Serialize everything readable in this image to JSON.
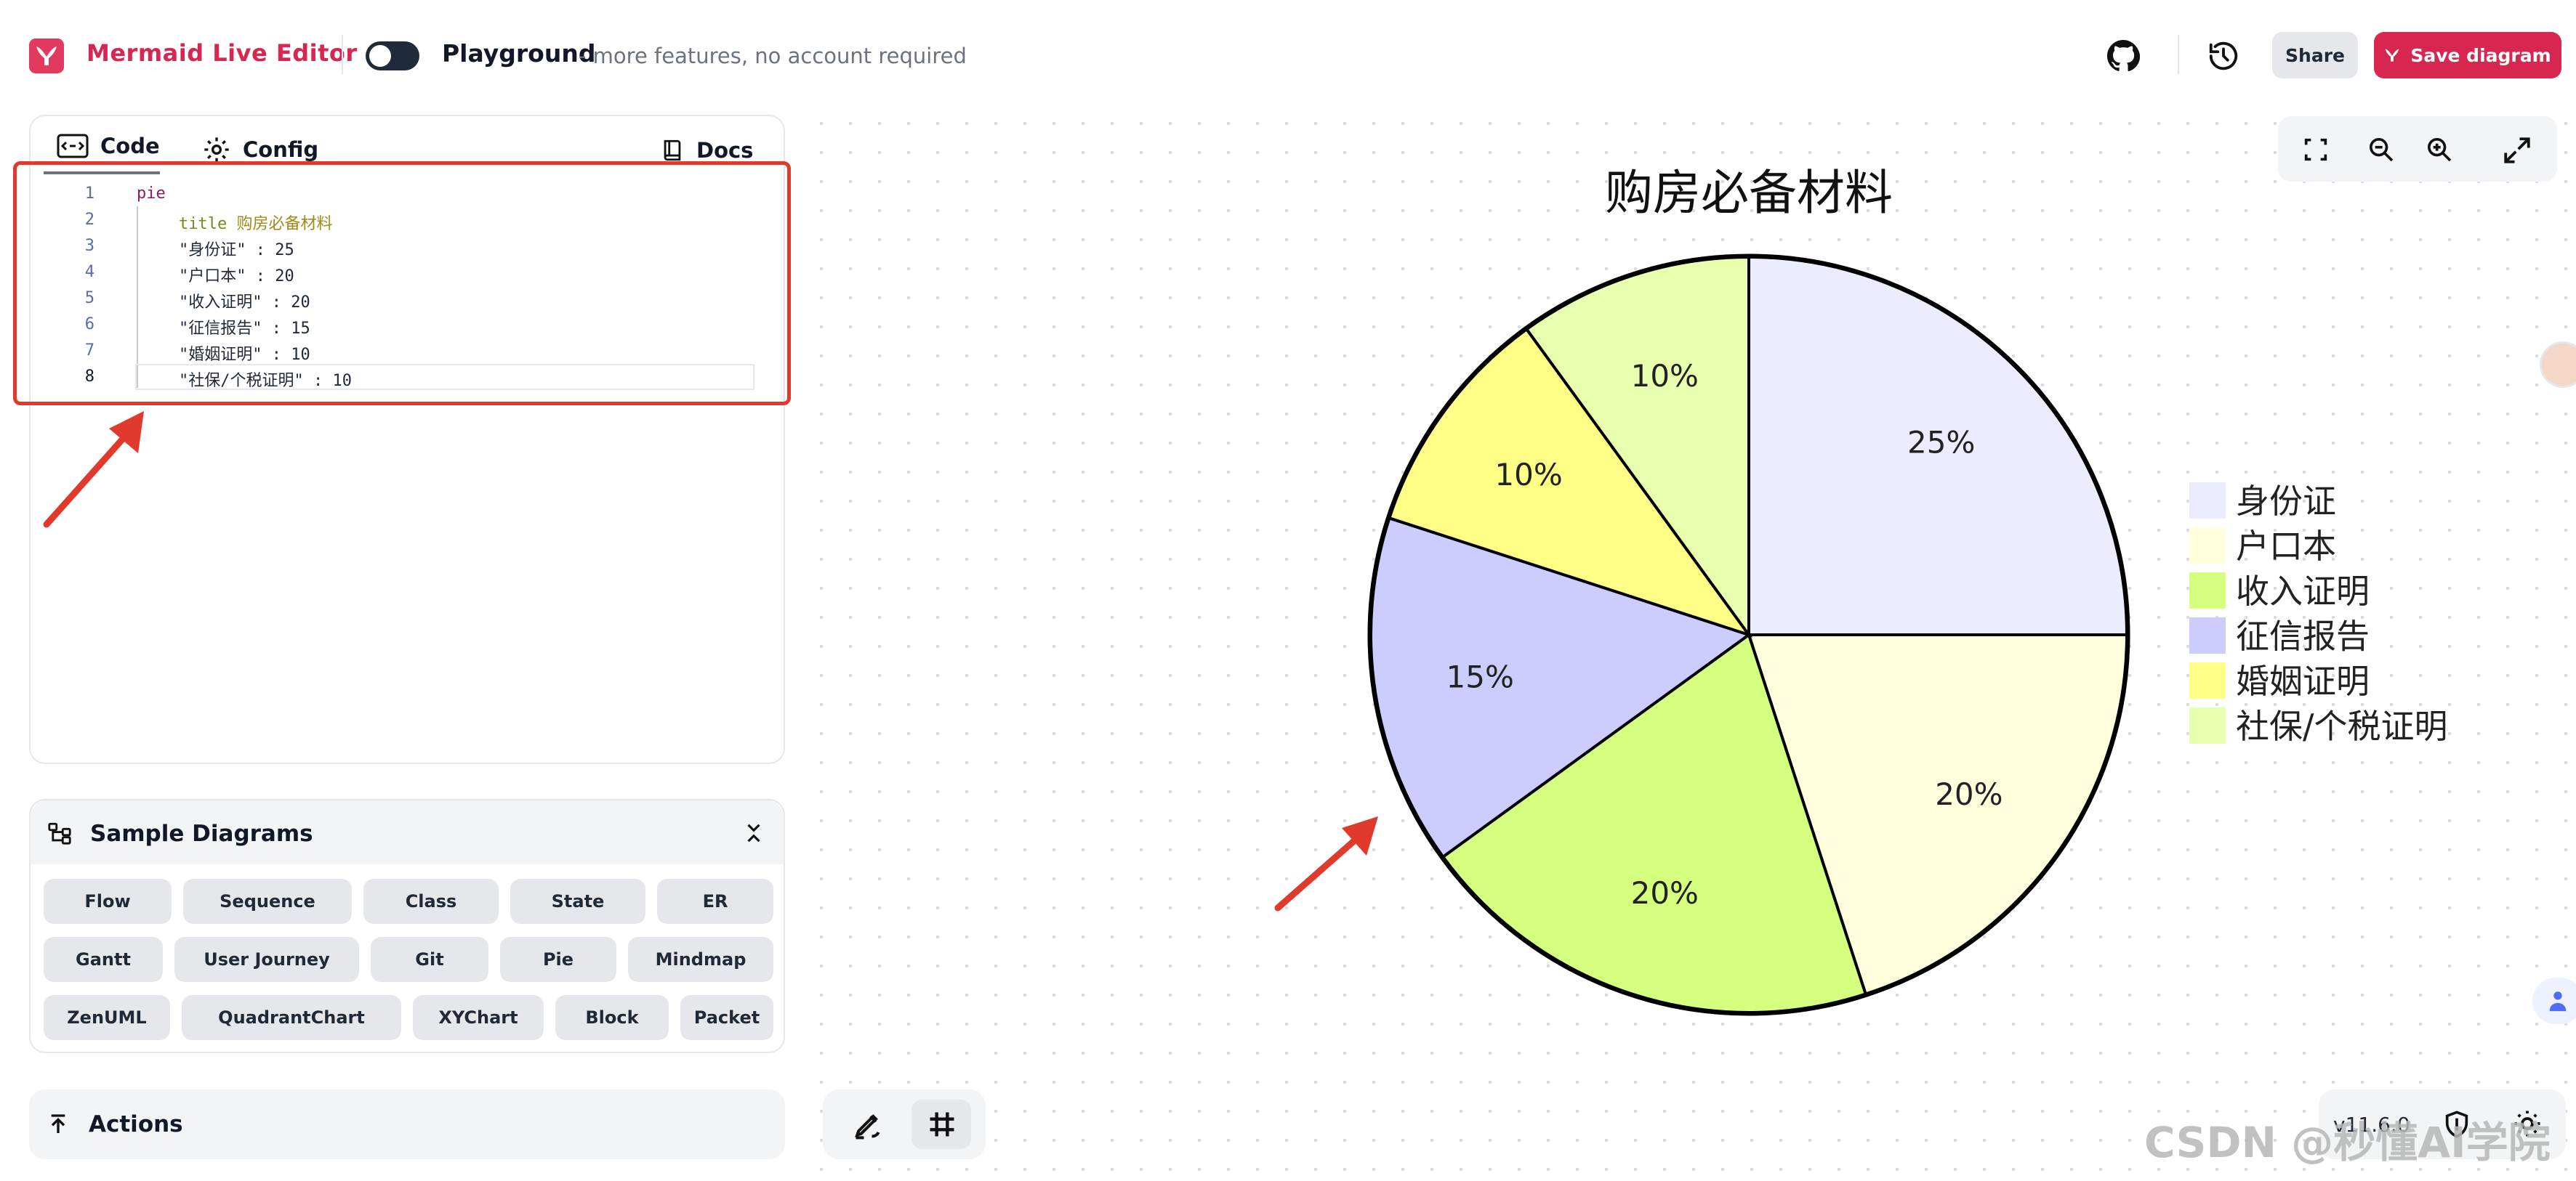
{
  "header": {
    "app_title": "Mermaid Live Editor",
    "playground_title": "Playground",
    "playground_subtitle": "- more features, no account required",
    "share_label": "Share",
    "save_label": "Save diagram"
  },
  "editor": {
    "tabs": [
      {
        "label": "Code",
        "active": true
      },
      {
        "label": "Config",
        "active": false
      },
      {
        "label": "Docs",
        "active": false
      }
    ],
    "lines": [
      {
        "num": "1",
        "text": "pie"
      },
      {
        "num": "2",
        "kw": "title",
        "text": "购房必备材料"
      },
      {
        "num": "3",
        "text": "\"身份证\" : 25"
      },
      {
        "num": "4",
        "text": "\"户口本\" : 20"
      },
      {
        "num": "5",
        "text": "\"收入证明\" : 20"
      },
      {
        "num": "6",
        "text": "\"征信报告\" : 15"
      },
      {
        "num": "7",
        "text": "\"婚姻证明\" : 10"
      },
      {
        "num": "8",
        "text": "\"社保/个税证明\" : 10"
      }
    ]
  },
  "samples": {
    "title": "Sample Diagrams",
    "buttons": [
      "Flow",
      "Sequence",
      "Class",
      "State",
      "ER",
      "Gantt",
      "User Journey",
      "Git",
      "Pie",
      "Mindmap",
      "ZenUML",
      "QuadrantChart",
      "XYChart",
      "Block",
      "Packet"
    ]
  },
  "actions": {
    "label": "Actions"
  },
  "footer": {
    "version": "v11.6.0",
    "watermark": "CSDN @秒懂AI学院"
  },
  "colors": {
    "brand": "#d7264f",
    "highlight": "#e03a2c"
  },
  "chart_data": {
    "type": "pie",
    "title": "购房必备材料",
    "labels": [
      "身份证",
      "户口本",
      "收入证明",
      "征信报告",
      "婚姻证明",
      "社保/个税证明"
    ],
    "values": [
      25,
      20,
      20,
      15,
      10,
      10
    ],
    "percent_labels": [
      "25%",
      "20%",
      "20%",
      "15%",
      "10%",
      "10%"
    ],
    "colors": [
      "#ECECFF",
      "#FFFFDE",
      "#D4FF7F",
      "#CCCCFF",
      "#FFFF88",
      "#E8FFB0"
    ],
    "legend": "right"
  }
}
